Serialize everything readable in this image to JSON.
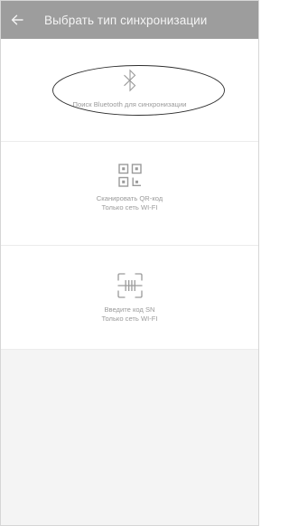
{
  "header": {
    "back_icon": "arrow-left-icon",
    "title": "Выбрать тип синхронизации",
    "background": "#9d9d9d"
  },
  "options": [
    {
      "icon": "bluetooth-icon",
      "label": "Поиск Bluetooth для синхронизации"
    },
    {
      "icon": "qr-code-icon",
      "line1": "Сканировать QR-код",
      "line2": "Только сеть WI-FI"
    },
    {
      "icon": "barcode-scan-icon",
      "line1": "Введите код SN",
      "line2": "Только сеть WI-FI"
    }
  ]
}
